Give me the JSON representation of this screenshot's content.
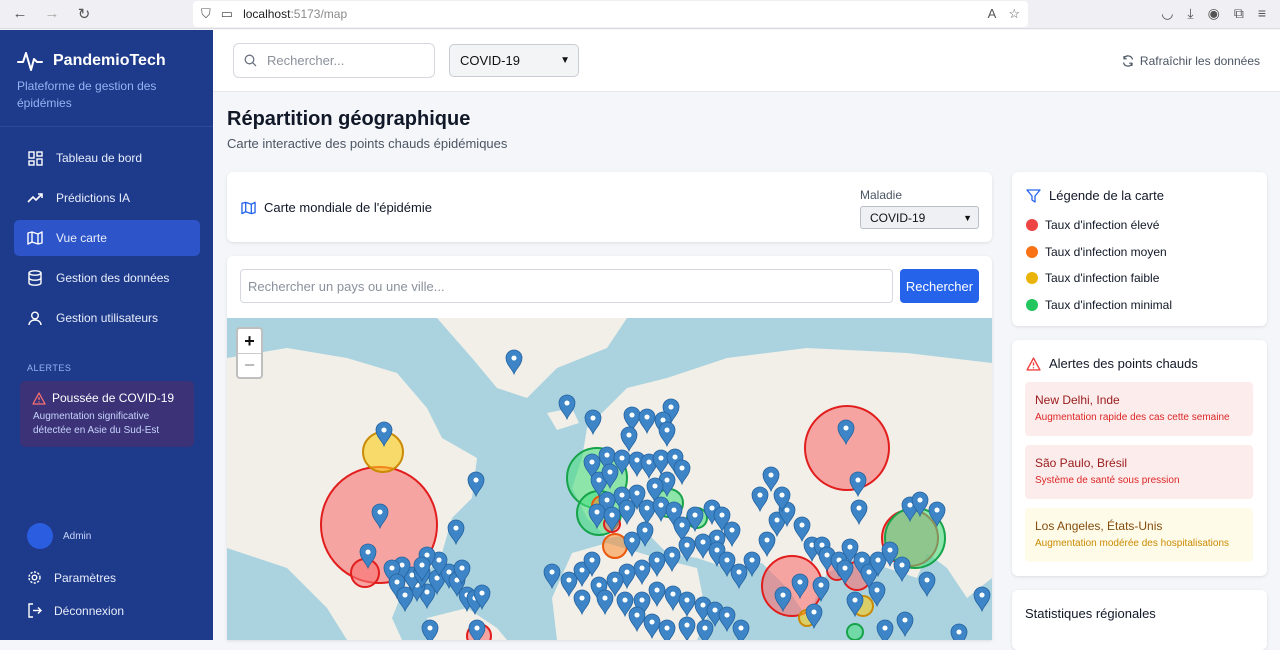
{
  "browser": {
    "url_host": "localhost",
    "url_path": ":5173/map"
  },
  "sidebar": {
    "brand": "PandemioTech",
    "subtitle": "Plateforme de gestion des épidémies",
    "items": [
      {
        "label": "Tableau de bord",
        "icon": "dashboard-icon"
      },
      {
        "label": "Prédictions IA",
        "icon": "trending-icon"
      },
      {
        "label": "Vue carte",
        "icon": "map-icon",
        "active": true
      },
      {
        "label": "Gestion des données",
        "icon": "database-icon"
      },
      {
        "label": "Gestion utilisateurs",
        "icon": "user-icon"
      }
    ],
    "alerts_label": "ALERTES",
    "alert": {
      "title": "Poussée de COVID-19",
      "desc": "Augmentation significative détectée en Asie du Sud-Est"
    },
    "user": "Admin",
    "settings": "Paramètres",
    "logout": "Déconnexion"
  },
  "topbar": {
    "search_placeholder": "Rechercher...",
    "disease": "COVID-19",
    "refresh": "Rafraîchir les données"
  },
  "page": {
    "title": "Répartition géographique",
    "subtitle": "Carte interactive des points chauds épidémiques"
  },
  "map_header": {
    "title": "Carte mondiale de l'épidémie",
    "disease_label": "Maladie",
    "disease": "COVID-19"
  },
  "map_search": {
    "placeholder": "Rechercher un pays ou une ville...",
    "button": "Rechercher"
  },
  "zoom": {
    "plus": "+",
    "minus": "−"
  },
  "legend": {
    "title": "Légende de la carte",
    "items": [
      {
        "label": "Taux d'infection élevé",
        "color": "#ef4444"
      },
      {
        "label": "Taux d'infection moyen",
        "color": "#f97316"
      },
      {
        "label": "Taux d'infection faible",
        "color": "#eab308"
      },
      {
        "label": "Taux d'infection minimal",
        "color": "#22c55e"
      }
    ]
  },
  "hotspots": {
    "title": "Alertes des points chauds",
    "items": [
      {
        "name": "New Delhi, Inde",
        "desc": "Augmentation rapide des cas cette semaine",
        "level": "high"
      },
      {
        "name": "São Paulo, Brésil",
        "desc": "Système de santé sous pression",
        "level": "high"
      },
      {
        "name": "Los Angeles, États-Unis",
        "desc": "Augmentation modérée des hospitalisations",
        "level": "medium"
      }
    ]
  },
  "stats": {
    "title": "Statistiques régionales"
  }
}
